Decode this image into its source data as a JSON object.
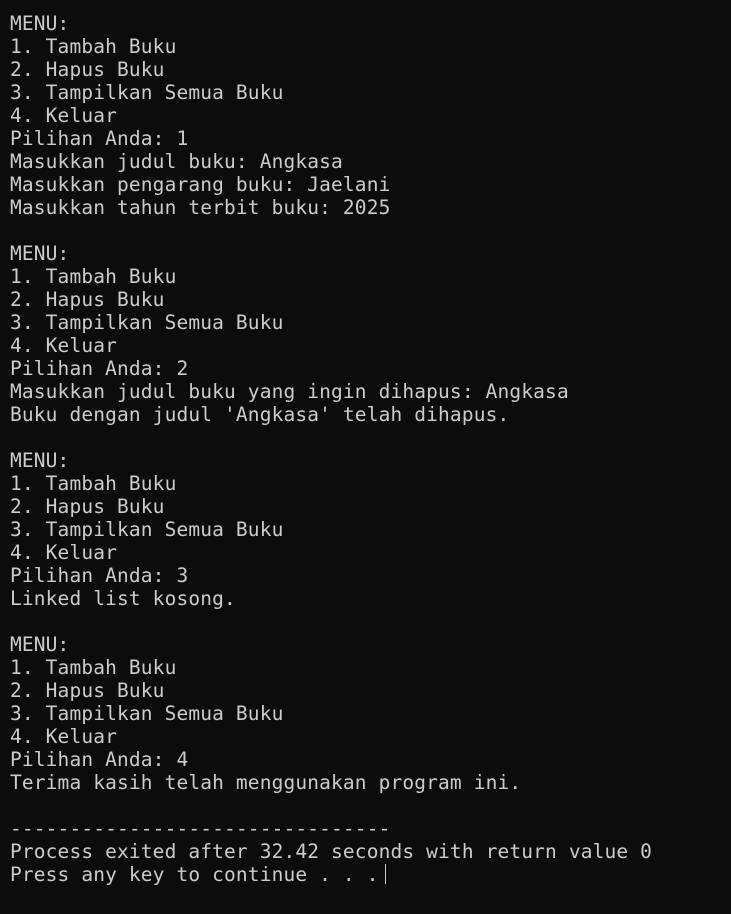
{
  "console": {
    "lines": [
      "MENU:",
      "1. Tambah Buku",
      "2. Hapus Buku",
      "3. Tampilkan Semua Buku",
      "4. Keluar",
      "Pilihan Anda: 1",
      "Masukkan judul buku: Angkasa",
      "Masukkan pengarang buku: Jaelani",
      "Masukkan tahun terbit buku: 2025",
      "",
      "MENU:",
      "1. Tambah Buku",
      "2. Hapus Buku",
      "3. Tampilkan Semua Buku",
      "4. Keluar",
      "Pilihan Anda: 2",
      "Masukkan judul buku yang ingin dihapus: Angkasa",
      "Buku dengan judul 'Angkasa' telah dihapus.",
      "",
      "MENU:",
      "1. Tambah Buku",
      "2. Hapus Buku",
      "3. Tampilkan Semua Buku",
      "4. Keluar",
      "Pilihan Anda: 3",
      "Linked list kosong.",
      "",
      "MENU:",
      "1. Tambah Buku",
      "2. Hapus Buku",
      "3. Tampilkan Semua Buku",
      "4. Keluar",
      "Pilihan Anda: 4",
      "Terima kasih telah menggunakan program ini.",
      "",
      "--------------------------------",
      "Process exited after 32.42 seconds with return value 0"
    ],
    "prompt_line": "Press any key to continue . . .",
    "background_color": "#0c0c0c",
    "text_color": "#cccccc"
  }
}
